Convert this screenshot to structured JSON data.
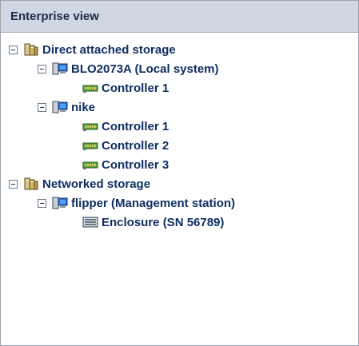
{
  "panel": {
    "title": "Enterprise view"
  },
  "tree": {
    "nodes": [
      {
        "label": "Direct attached storage",
        "icon": "storage-group-icon"
      },
      {
        "label": "BLO2073A (Local system)",
        "icon": "computer-icon"
      },
      {
        "label": "Controller 1",
        "icon": "controller-card-icon"
      },
      {
        "label": "nike",
        "icon": "computer-icon"
      },
      {
        "label": "Controller 1",
        "icon": "controller-card-icon"
      },
      {
        "label": "Controller 2",
        "icon": "controller-card-icon"
      },
      {
        "label": "Controller 3",
        "icon": "controller-card-icon"
      },
      {
        "label": "Networked storage",
        "icon": "storage-group-icon"
      },
      {
        "label": "flipper (Management station)",
        "icon": "computer-icon"
      },
      {
        "label": "Enclosure (SN 56789)",
        "icon": "enclosure-icon"
      }
    ]
  },
  "colors": {
    "header_bg": "#cfd7e2",
    "text": "#0f2f63",
    "accent_green": "#58a53a",
    "accent_blue": "#2f6fd8"
  }
}
